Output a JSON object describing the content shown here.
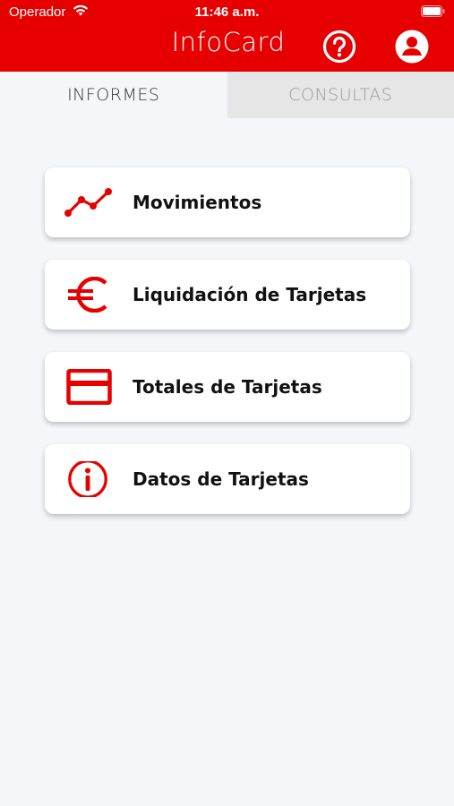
{
  "status_bar": {
    "carrier": "Operador",
    "time": "11:46 a.m."
  },
  "header": {
    "title": "InfoCard",
    "help_icon": "question-circle-icon",
    "profile_icon": "user-circle-icon"
  },
  "tabs": [
    {
      "label": "INFORMES",
      "active": true
    },
    {
      "label": "CONSULTAS",
      "active": false
    }
  ],
  "menu": {
    "items": [
      {
        "label": "Movimientos",
        "icon": "line-chart-icon"
      },
      {
        "label": "Liquidación de Tarjetas",
        "icon": "euro-icon"
      },
      {
        "label": "Totales de Tarjetas",
        "icon": "credit-card-icon"
      },
      {
        "label": "Datos de Tarjetas",
        "icon": "info-circle-icon"
      }
    ]
  },
  "colors": {
    "brand": "#e60000",
    "background": "#f4f6f9",
    "inactive_tab": "#e6e6e6"
  }
}
